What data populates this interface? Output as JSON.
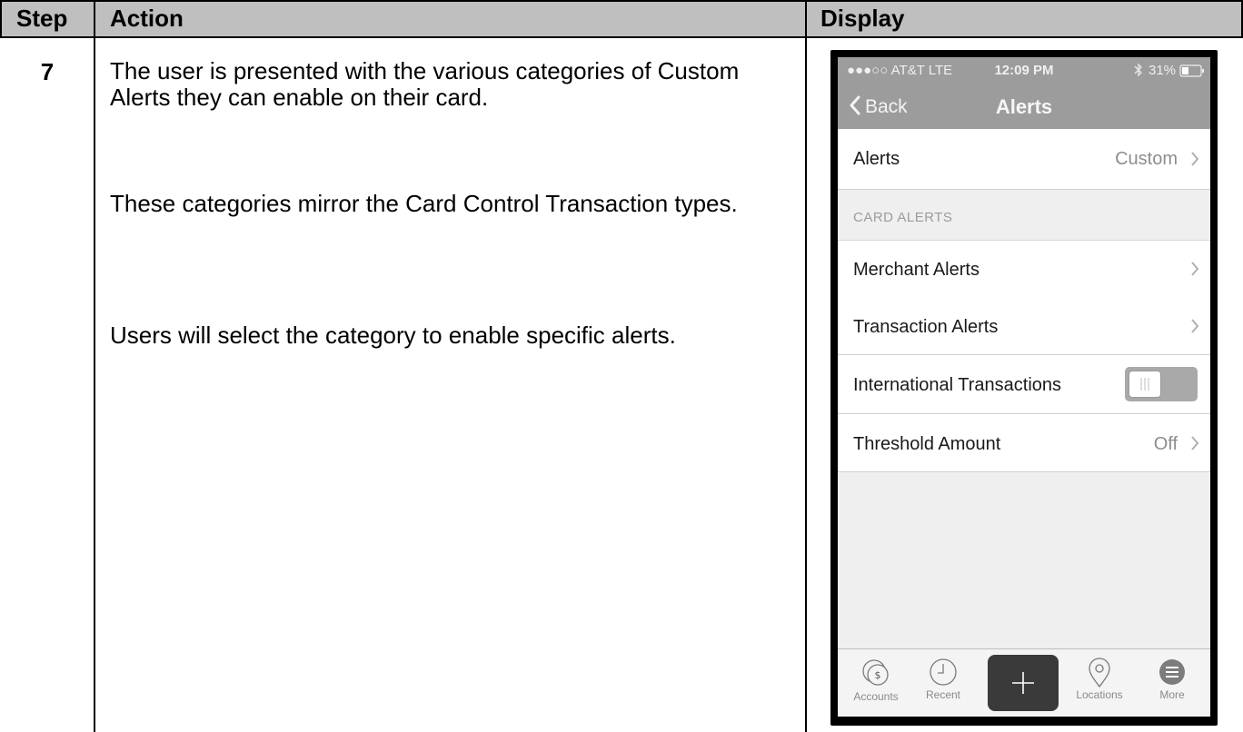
{
  "table": {
    "headers": {
      "step": "Step",
      "action": "Action",
      "display": "Display"
    },
    "step_number": "7",
    "action_paragraphs": [
      "The user is presented with the various categories of Custom Alerts they can enable on their card.",
      "These categories mirror the Card Control Transaction types.",
      "Users will select the category to enable specific alerts."
    ]
  },
  "phone": {
    "status_bar": {
      "carrier": "●●●○○ AT&T  LTE",
      "time": "12:09 PM",
      "battery": "31%"
    },
    "nav": {
      "back_label": "Back",
      "title": "Alerts"
    },
    "alerts_row": {
      "label": "Alerts",
      "value": "Custom"
    },
    "section_header": "CARD ALERTS",
    "rows": [
      {
        "label": "Merchant Alerts"
      },
      {
        "label": "Transaction Alerts"
      },
      {
        "label": "International Transactions",
        "toggle_on": false
      },
      {
        "label": "Threshold Amount",
        "value": "Off"
      }
    ],
    "tabbar": {
      "accounts": "Accounts",
      "recent": "Recent",
      "locations": "Locations",
      "more": "More"
    },
    "icons": [
      "chevron-left-icon",
      "chevron-right-icon",
      "bluetooth-icon",
      "battery-icon",
      "accounts-icon",
      "clock-icon",
      "plus-icon",
      "location-pin-icon",
      "more-icon"
    ]
  }
}
